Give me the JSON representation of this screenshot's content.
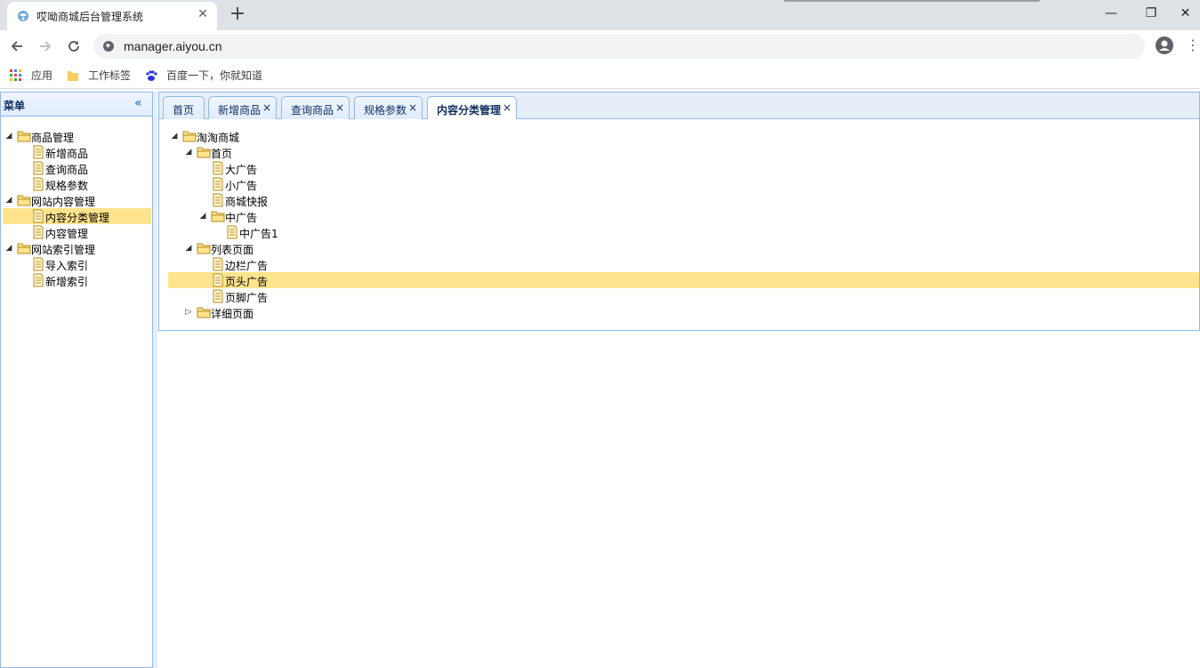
{
  "browser": {
    "tab_title": "哎呦商城后台管理系统",
    "tab_close": "✕",
    "new_tab": "+",
    "url": "manager.aiyou.cn",
    "win_minimize": "—",
    "win_restore": "❐",
    "win_close": "✕",
    "bookmarks": [
      {
        "label": "应用",
        "icon": "apps-grid-icon"
      },
      {
        "label": "工作标签",
        "icon": "folder-icon"
      },
      {
        "label": "百度一下，你就知道",
        "icon": "baidu-paw-icon"
      }
    ]
  },
  "west": {
    "title": "菜单",
    "collapse_icon": "«",
    "tree": [
      {
        "label": "商品管理",
        "type": "folder",
        "level": 0,
        "expanded": true
      },
      {
        "label": "新增商品",
        "type": "file",
        "level": 1
      },
      {
        "label": "查询商品",
        "type": "file",
        "level": 1
      },
      {
        "label": "规格参数",
        "type": "file",
        "level": 1
      },
      {
        "label": "网站内容管理",
        "type": "folder",
        "level": 0,
        "expanded": true
      },
      {
        "label": "内容分类管理",
        "type": "file",
        "level": 1,
        "selected": true
      },
      {
        "label": "内容管理",
        "type": "file",
        "level": 1
      },
      {
        "label": "网站索引管理",
        "type": "folder",
        "level": 0,
        "expanded": true
      },
      {
        "label": "导入索引",
        "type": "file",
        "level": 1
      },
      {
        "label": "新增索引",
        "type": "file",
        "level": 1
      }
    ]
  },
  "tabs": [
    {
      "label": "首页",
      "closable": false
    },
    {
      "label": "新增商品",
      "closable": true
    },
    {
      "label": "查询商品",
      "closable": true
    },
    {
      "label": "规格参数",
      "closable": true
    },
    {
      "label": "内容分类管理",
      "closable": true,
      "active": true
    }
  ],
  "tab_close_symbol": "×",
  "content_tree": [
    {
      "label": "淘淘商城",
      "type": "folder",
      "level": 0,
      "expanded": true
    },
    {
      "label": "首页",
      "type": "folder",
      "level": 1,
      "expanded": true
    },
    {
      "label": "大广告",
      "type": "file",
      "level": 2
    },
    {
      "label": "小广告",
      "type": "file",
      "level": 2
    },
    {
      "label": "商城快报",
      "type": "file",
      "level": 2
    },
    {
      "label": "中广告",
      "type": "folder",
      "level": 2,
      "expanded": true
    },
    {
      "label": "中广告1",
      "type": "file",
      "level": 3
    },
    {
      "label": "列表页面",
      "type": "folder",
      "level": 1,
      "expanded": true
    },
    {
      "label": "边栏广告",
      "type": "file",
      "level": 2
    },
    {
      "label": "页头广告",
      "type": "file",
      "level": 2,
      "selected": true
    },
    {
      "label": "页脚广告",
      "type": "file",
      "level": 2
    },
    {
      "label": "详细页面",
      "type": "folder",
      "level": 1,
      "expanded": false
    }
  ],
  "colors": {
    "selected_bg": "#ffe48d",
    "panel_border": "#95b8e7",
    "header_bg": "#e0ecff"
  }
}
